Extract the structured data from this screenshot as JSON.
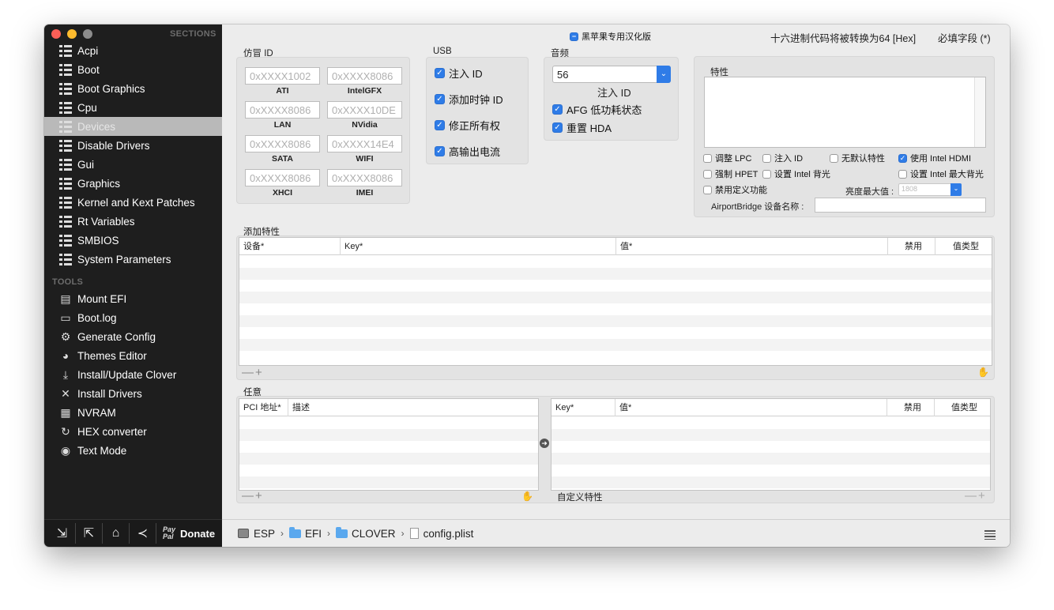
{
  "sidebar": {
    "sections_header": "SECTIONS",
    "tools_header": "TOOLS",
    "sections": [
      {
        "label": "Acpi",
        "icon": "list-icon"
      },
      {
        "label": "Boot",
        "icon": "list-icon"
      },
      {
        "label": "Boot Graphics",
        "icon": "list-icon"
      },
      {
        "label": "Cpu",
        "icon": "list-icon"
      },
      {
        "label": "Devices",
        "icon": "list-icon",
        "selected": true
      },
      {
        "label": "Disable Drivers",
        "icon": "list-icon"
      },
      {
        "label": "Gui",
        "icon": "list-icon"
      },
      {
        "label": "Graphics",
        "icon": "list-icon"
      },
      {
        "label": "Kernel and Kext Patches",
        "icon": "list-icon"
      },
      {
        "label": "Rt Variables",
        "icon": "list-icon"
      },
      {
        "label": "SMBIOS",
        "icon": "list-icon"
      },
      {
        "label": "System Parameters",
        "icon": "list-icon"
      }
    ],
    "tools": [
      {
        "label": "Mount EFI",
        "icon": "drive-icon"
      },
      {
        "label": "Boot.log",
        "icon": "log-icon"
      },
      {
        "label": "Generate Config",
        "icon": "gears-icon"
      },
      {
        "label": "Themes Editor",
        "icon": "palette-icon"
      },
      {
        "label": "Install/Update Clover",
        "icon": "download-icon"
      },
      {
        "label": "Install Drivers",
        "icon": "tools-icon"
      },
      {
        "label": "NVRAM",
        "icon": "chip-icon"
      },
      {
        "label": "HEX converter",
        "icon": "refresh-icon"
      },
      {
        "label": "Text Mode",
        "icon": "eye-icon"
      }
    ],
    "footer": {
      "paypal_label": "Pay\nPal",
      "donate_label": "Donate"
    }
  },
  "header": {
    "localized_checkbox": "黑苹果专用汉化版",
    "hex_notice": "十六进制代码将被转换为64 [Hex]",
    "required_notice": "必填字段 (*)"
  },
  "fake_id": {
    "title": "仿冒 ID",
    "fields": [
      {
        "placeholder": "0xXXXX1002",
        "label": "ATI"
      },
      {
        "placeholder": "0xXXXX8086",
        "label": "IntelGFX"
      },
      {
        "placeholder": "0xXXXX8086",
        "label": "LAN"
      },
      {
        "placeholder": "0xXXXX10DE",
        "label": "NVidia"
      },
      {
        "placeholder": "0xXXXX8086",
        "label": "SATA"
      },
      {
        "placeholder": "0xXXXX14E4",
        "label": "WIFI"
      },
      {
        "placeholder": "0xXXXX8086",
        "label": "XHCI"
      },
      {
        "placeholder": "0xXXXX8086",
        "label": "IMEI"
      }
    ]
  },
  "usb": {
    "title": "USB",
    "options": [
      {
        "label": "注入 ID",
        "checked": true
      },
      {
        "label": "添加时钟 ID",
        "checked": true
      },
      {
        "label": "修正所有权",
        "checked": true
      },
      {
        "label": "高输出电流",
        "checked": true
      }
    ]
  },
  "audio": {
    "title": "音频",
    "inject_value": "56",
    "inject_label": "注入 ID",
    "options": [
      {
        "label": "AFG 低功耗状态",
        "checked": true
      },
      {
        "label": "重置 HDA",
        "checked": true
      }
    ]
  },
  "properties": {
    "title": "特性",
    "text": "",
    "checkboxes": [
      {
        "label": "调整 LPC",
        "checked": false
      },
      {
        "label": "注入 ID",
        "checked": false
      },
      {
        "label": "无默认特性",
        "checked": false
      },
      {
        "label": "使用 Intel HDMI",
        "checked": true
      },
      {
        "label": "强制 HPET",
        "checked": false
      },
      {
        "label": "设置 Intel 背光",
        "checked": false
      },
      {
        "label": "设置 Intel 最大背光",
        "checked": false
      },
      {
        "label": "禁用定义功能",
        "checked": false
      }
    ],
    "brightness_label": "亮度最大值 :",
    "brightness_value": "1808",
    "airport_label": "AirportBridge 设备名称 :",
    "airport_value": ""
  },
  "add_properties": {
    "title": "添加特性",
    "columns": [
      "设备*",
      "Key*",
      "值*",
      "禁用",
      "值类型"
    ],
    "rows": []
  },
  "arbitrary": {
    "title": "任意",
    "left_columns": [
      "PCI 地址*",
      "描述"
    ],
    "right_columns": [
      "Key*",
      "值*",
      "禁用",
      "值类型"
    ],
    "custom_label": "自定义特性",
    "rows": []
  },
  "controls": {
    "minus": "—",
    "plus": "+"
  },
  "pathbar": {
    "crumbs": [
      "ESP",
      "EFI",
      "CLOVER",
      "config.plist"
    ],
    "separator": "›"
  },
  "colors": {
    "accent": "#2f7ce7",
    "sidebar_bg": "#1e1e1e",
    "selected_bg": "#b9b9b9"
  }
}
